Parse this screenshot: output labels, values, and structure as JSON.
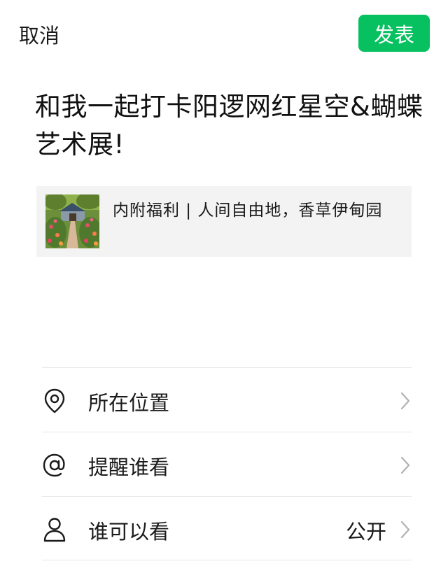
{
  "header": {
    "cancel_label": "取消",
    "publish_label": "发表"
  },
  "post": {
    "text": "和我一起打卡阳逻网红星空&蝴蝶艺术展!"
  },
  "link_card": {
    "title": "内附福利 | 人间自由地，香草伊甸园",
    "thumbnail_icon": "garden-photo"
  },
  "menu": {
    "location": {
      "icon": "location-pin-icon",
      "label": "所在位置"
    },
    "remind": {
      "icon": "at-icon",
      "label": "提醒谁看"
    },
    "visibility": {
      "icon": "person-icon",
      "label": "谁可以看",
      "value": "公开"
    }
  },
  "colors": {
    "accent": "#07c160",
    "card_bg": "#f3f3f3",
    "divider": "#e6e6e6",
    "chevron": "#b2b2b2"
  }
}
